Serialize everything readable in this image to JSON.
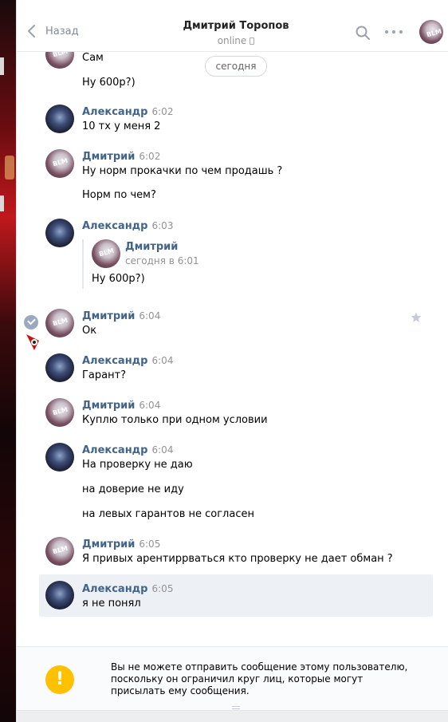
{
  "header": {
    "back_label": "Назад",
    "peer_name": "Дмитрий Торопов",
    "peer_status": "online",
    "icons": [
      "chevron-left-icon",
      "search-icon",
      "more-icon",
      "avatar"
    ]
  },
  "date_divider": "сегодня",
  "messages": [
    {
      "author": "",
      "time": "",
      "lines": [
        "Сам",
        "Ну 600р?)"
      ]
    },
    {
      "author": "Александр",
      "time": "6:02",
      "lines": [
        "10 тх у меня 2"
      ]
    },
    {
      "author": "Дмитрий",
      "time": "6:02",
      "lines": [
        "Ну норм прокачки по чем продашь ?",
        "Норм по чем?"
      ]
    },
    {
      "author": "Александр",
      "time": "6:03",
      "forward": {
        "author": "Дмитрий",
        "date": "сегодня в 6:01",
        "text": "Ну 600р?)"
      }
    },
    {
      "author": "Дмитрий",
      "time": "6:04",
      "lines": [
        "Ок"
      ]
    },
    {
      "author": "Александр",
      "time": "6:04",
      "lines": [
        "Гарант?"
      ]
    },
    {
      "author": "Дмитрий",
      "time": "6:04",
      "lines": [
        "Куплю только при одном условии"
      ]
    },
    {
      "author": "Александр",
      "time": "6:04",
      "lines": [
        "На проверку не даю",
        "на доверие не иду",
        "на левых гарантов не согласен"
      ]
    },
    {
      "author": "Дмитрий",
      "time": "6:05",
      "lines": [
        "Я привых арентиррваться кто проверку не дает обман ?"
      ]
    },
    {
      "author": "Александр",
      "time": "6:05",
      "lines": [
        "я не понял"
      ]
    }
  ],
  "notice": {
    "icon": "!",
    "text": "Вы не можете отправить сообщение этому пользователю, поскольку он ограничил круг лиц, которые могут присылать ему сообщения."
  },
  "colors": {
    "author": "#42648b",
    "time": "#939393",
    "selected_bg": "#edf0f5",
    "warning": "#ffc000"
  }
}
